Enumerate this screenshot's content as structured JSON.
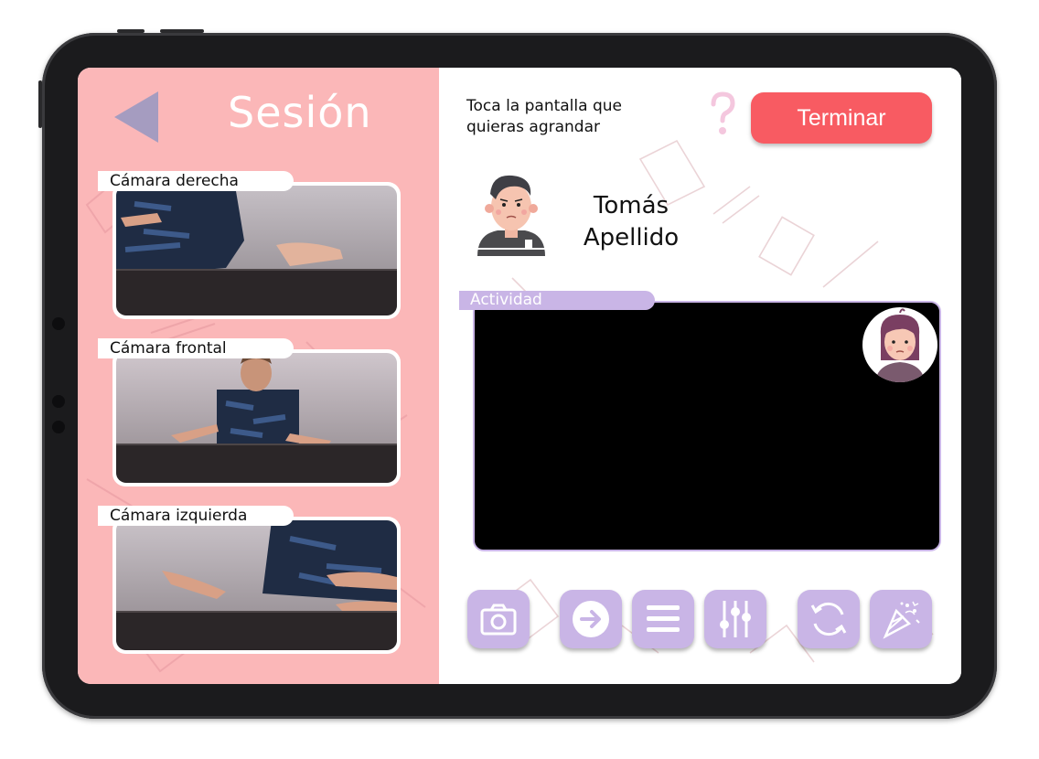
{
  "header": {
    "title": "Sesión"
  },
  "cameras": [
    {
      "label": "Cámara derecha"
    },
    {
      "label": "Cámara frontal"
    },
    {
      "label": "Cámara izquierda"
    }
  ],
  "instructions": "Toca la pantalla que quieras agrandar",
  "finish_label": "Terminar",
  "student": {
    "first_name": "Tomás",
    "last_name": "Apellido"
  },
  "activity_label": "Actividad",
  "toolbar": [
    {
      "icon": "camera-icon"
    },
    {
      "icon": "arrow-right-icon"
    },
    {
      "icon": "menu-icon"
    },
    {
      "icon": "sliders-icon"
    },
    {
      "icon": "refresh-icon"
    },
    {
      "icon": "confetti-icon"
    }
  ],
  "colors": {
    "panel_pink": "#fbb7b8",
    "accent_lavender": "#c9b5e6",
    "finish_red": "#f85b62",
    "back_arrow": "#a59cc0"
  }
}
